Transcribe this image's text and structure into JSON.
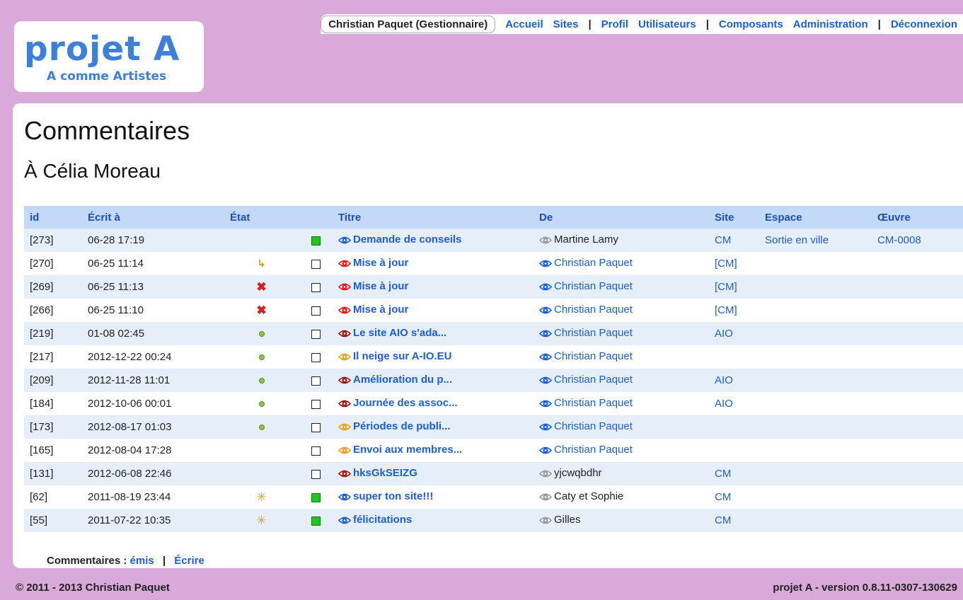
{
  "logo": {
    "title": "projet A",
    "subtitle": "A comme Artistes"
  },
  "topnav": {
    "user": "Christian Paquet (Gestionnaire)",
    "items": [
      {
        "label": "Accueil"
      },
      {
        "label": "Sites"
      },
      {
        "sep": "|"
      },
      {
        "label": "Profil"
      },
      {
        "label": "Utilisateurs"
      },
      {
        "sep": "|"
      },
      {
        "label": "Composants"
      },
      {
        "label": "Administration"
      },
      {
        "sep": "|"
      },
      {
        "label": "Déconnexion"
      }
    ]
  },
  "page": {
    "title": "Commentaires",
    "subtitle": "À Célia Moreau"
  },
  "table": {
    "headers": {
      "id": "id",
      "date": "Écrit à",
      "etat": "État",
      "titre": "Titre",
      "de": "De",
      "site": "Site",
      "espace": "Espace",
      "oeuvre": "Œuvre"
    },
    "rows": [
      {
        "id": "[273]",
        "date": "06-28 17:19",
        "status": "",
        "box": "green",
        "eye": "blue",
        "titre": "Demande de conseils",
        "de_eye": "gray",
        "de": "Martine Lamy",
        "site": "CM",
        "espace": "Sortie en ville",
        "oeuvre": "CM-0008"
      },
      {
        "id": "[270]",
        "date": "06-25 11:14",
        "status": "reply",
        "box": "empty",
        "eye": "red",
        "titre": "Mise à jour",
        "de_eye": "blue",
        "de": "Christian Paquet",
        "site": "[CM]",
        "espace": "",
        "oeuvre": ""
      },
      {
        "id": "[269]",
        "date": "06-25 11:13",
        "status": "x",
        "box": "empty",
        "eye": "red",
        "titre": "Mise à jour",
        "de_eye": "blue",
        "de": "Christian Paquet",
        "site": "[CM]",
        "espace": "",
        "oeuvre": ""
      },
      {
        "id": "[266]",
        "date": "06-25 11:10",
        "status": "x",
        "box": "empty",
        "eye": "red",
        "titre": "Mise à jour",
        "de_eye": "blue",
        "de": "Christian Paquet",
        "site": "[CM]",
        "espace": "",
        "oeuvre": ""
      },
      {
        "id": "[219]",
        "date": "01-08 02:45",
        "status": "dot",
        "box": "empty",
        "eye": "darkred",
        "titre": "Le site AIO s'ada...",
        "de_eye": "blue",
        "de": "Christian Paquet",
        "site": "AIO",
        "espace": "",
        "oeuvre": ""
      },
      {
        "id": "[217]",
        "date": "2012-12-22 00:24",
        "status": "dot",
        "box": "empty",
        "eye": "orange",
        "titre": "Il neige sur A-IO.EU",
        "de_eye": "blue",
        "de": "Christian Paquet",
        "site": "",
        "espace": "",
        "oeuvre": ""
      },
      {
        "id": "[209]",
        "date": "2012-11-28 11:01",
        "status": "dot",
        "box": "empty",
        "eye": "darkred",
        "titre": "Amélioration du p...",
        "de_eye": "blue",
        "de": "Christian Paquet",
        "site": "AIO",
        "espace": "",
        "oeuvre": ""
      },
      {
        "id": "[184]",
        "date": "2012-10-06 00:01",
        "status": "dot",
        "box": "empty",
        "eye": "darkred",
        "titre": "Journée des assoc...",
        "de_eye": "blue",
        "de": "Christian Paquet",
        "site": "AIO",
        "espace": "",
        "oeuvre": ""
      },
      {
        "id": "[173]",
        "date": "2012-08-17 01:03",
        "status": "dot",
        "box": "empty",
        "eye": "orange",
        "titre": "Périodes de publi...",
        "de_eye": "blue",
        "de": "Christian Paquet",
        "site": "",
        "espace": "",
        "oeuvre": ""
      },
      {
        "id": "[165]",
        "date": "2012-08-04 17:28",
        "status": "",
        "box": "empty",
        "eye": "orange",
        "titre": "Envoi aux membres...",
        "de_eye": "blue",
        "de": "Christian Paquet",
        "site": "",
        "espace": "",
        "oeuvre": ""
      },
      {
        "id": "[131]",
        "date": "2012-06-08 22:46",
        "status": "",
        "box": "empty",
        "eye": "darkred",
        "titre": "hksGkSEIZG",
        "de_eye": "gray",
        "de": "yjcwqbdhr",
        "site": "CM",
        "espace": "",
        "oeuvre": ""
      },
      {
        "id": "[62]",
        "date": "2011-08-19 23:44",
        "status": "star",
        "box": "green",
        "eye": "blue",
        "titre": "super ton site!!!",
        "de_eye": "gray",
        "de": "Caty et Sophie",
        "site": "CM",
        "espace": "",
        "oeuvre": ""
      },
      {
        "id": "[55]",
        "date": "2011-07-22 10:35",
        "status": "star",
        "box": "green",
        "eye": "blue",
        "titre": "félicitations",
        "de_eye": "gray",
        "de": "Gilles",
        "site": "CM",
        "espace": "",
        "oeuvre": ""
      }
    ]
  },
  "bottom": {
    "label": "Commentaires :",
    "emis": "émis",
    "sep": "|",
    "ecrire": "Écrire"
  },
  "footer": {
    "left": "© 2011 - 2013 Christian Paquet",
    "right": "projet A - version 0.8.11-0307-130629"
  },
  "colors": {
    "background": "#d9a9d9",
    "header_row": "#c4d9f7",
    "row_alt": "#e6eef9",
    "link": "#1a5fd6",
    "eye_blue": "#1a5fd6",
    "eye_red": "#e01b1b",
    "eye_darkred": "#a01414",
    "eye_orange": "#f0a020",
    "eye_gray": "#9a9a9a"
  }
}
